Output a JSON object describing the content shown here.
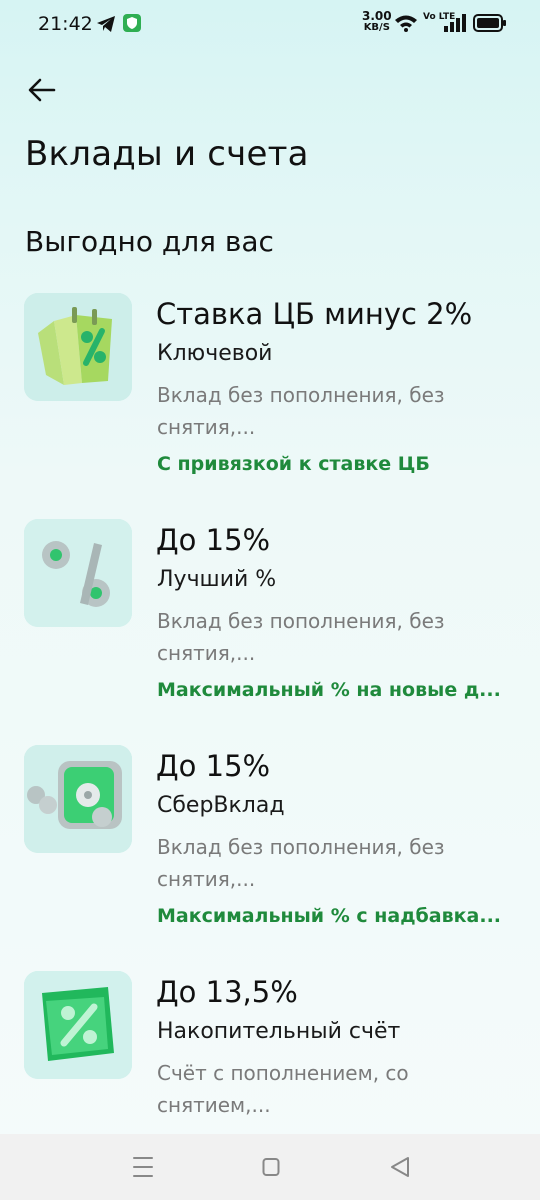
{
  "status_bar": {
    "time": "21:42",
    "net_speed_value": "3.00",
    "net_speed_unit": "KB/S",
    "volte": "Vo LTE"
  },
  "header": {
    "back_icon": "arrow-left-icon",
    "title": "Вклады и счета"
  },
  "section": {
    "title": "Выгодно для вас"
  },
  "products": [
    {
      "rate": "Ставка ЦБ минус 2%",
      "name": "Ключевой",
      "description": "Вклад без пополнения, без снятия,...",
      "tag": "С привязкой к ставке ЦБ",
      "icon": "calendar-percent-icon"
    },
    {
      "rate": "До 15%",
      "name": "Лучший %",
      "description": "Вклад без пополнения, без снятия,...",
      "tag": "Максимальный % на новые д...",
      "icon": "percent-sign-icon"
    },
    {
      "rate": "До 15%",
      "name": "СберВклад",
      "description": "Вклад без пополнения, без снятия,...",
      "tag": "Максимальный % с надбавка...",
      "icon": "safe-icon"
    },
    {
      "rate": "До 13,5%",
      "name": "Накопительный счёт",
      "description": "Счёт с пополнением, со снятием,...",
      "icon": "wallet-percent-icon"
    }
  ],
  "colors": {
    "accent_green": "#1f8a3c",
    "background": "#e3f7f6",
    "thumb_bg": "#c9eeea"
  }
}
